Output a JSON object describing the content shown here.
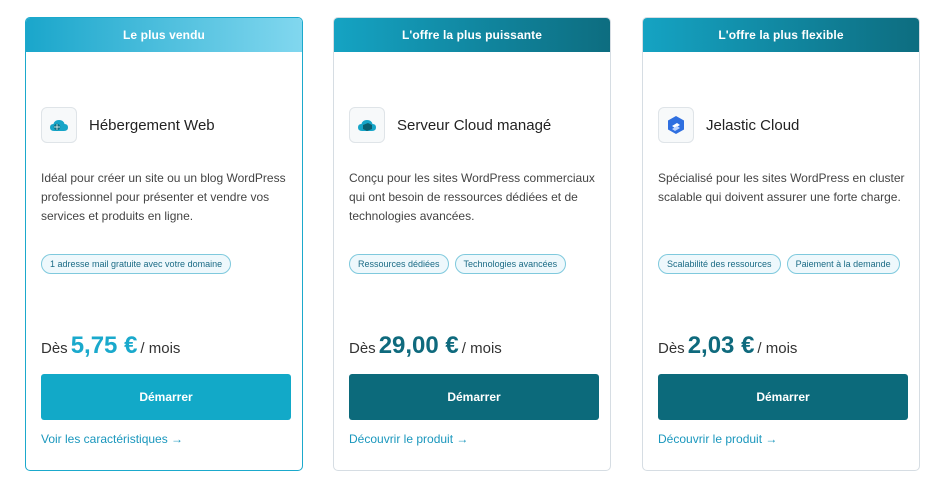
{
  "cards": [
    {
      "badge": "Le plus vendu",
      "name": "Hébergement Web",
      "icon": "cloud-globe-icon",
      "description": "Idéal pour créer un site ou un blog WordPress professionnel pour présenter et vendre vos services et produits en ligne.",
      "tags": [
        "1 adresse mail gratuite avec votre domaine"
      ],
      "price_prefix": "Dès",
      "price": "5,75 €",
      "price_suffix": "/ mois",
      "cta": "Démarrer",
      "link": "Voir les caractéristiques →"
    },
    {
      "badge": "L'offre la plus puissante",
      "name": "Serveur Cloud managé",
      "icon": "cloud-server-icon",
      "description": "Conçu pour les sites WordPress commerciaux qui ont besoin de ressources dédiées et de technologies avancées.",
      "tags": [
        "Ressources dédiées",
        "Technologies avancées"
      ],
      "price_prefix": "Dès",
      "price": "29,00 €",
      "price_suffix": "/ mois",
      "cta": "Démarrer",
      "link": "Découvrir le produit →"
    },
    {
      "badge": "L'offre la plus flexible",
      "name": "Jelastic Cloud",
      "icon": "jelastic-icon",
      "description": "Spécialisé pour les sites WordPress en cluster scalable qui doivent assurer une forte charge.",
      "tags": [
        "Scalabilité des ressources",
        "Paiement à la demande"
      ],
      "price_prefix": "Dès",
      "price": "2,03 €",
      "price_suffix": "/ mois",
      "cta": "Démarrer",
      "link": "Découvrir le produit →"
    }
  ],
  "colors": {
    "accent_light": "#12a9c8",
    "accent_dark": "#0c6a7b",
    "link": "#1a97bd"
  }
}
